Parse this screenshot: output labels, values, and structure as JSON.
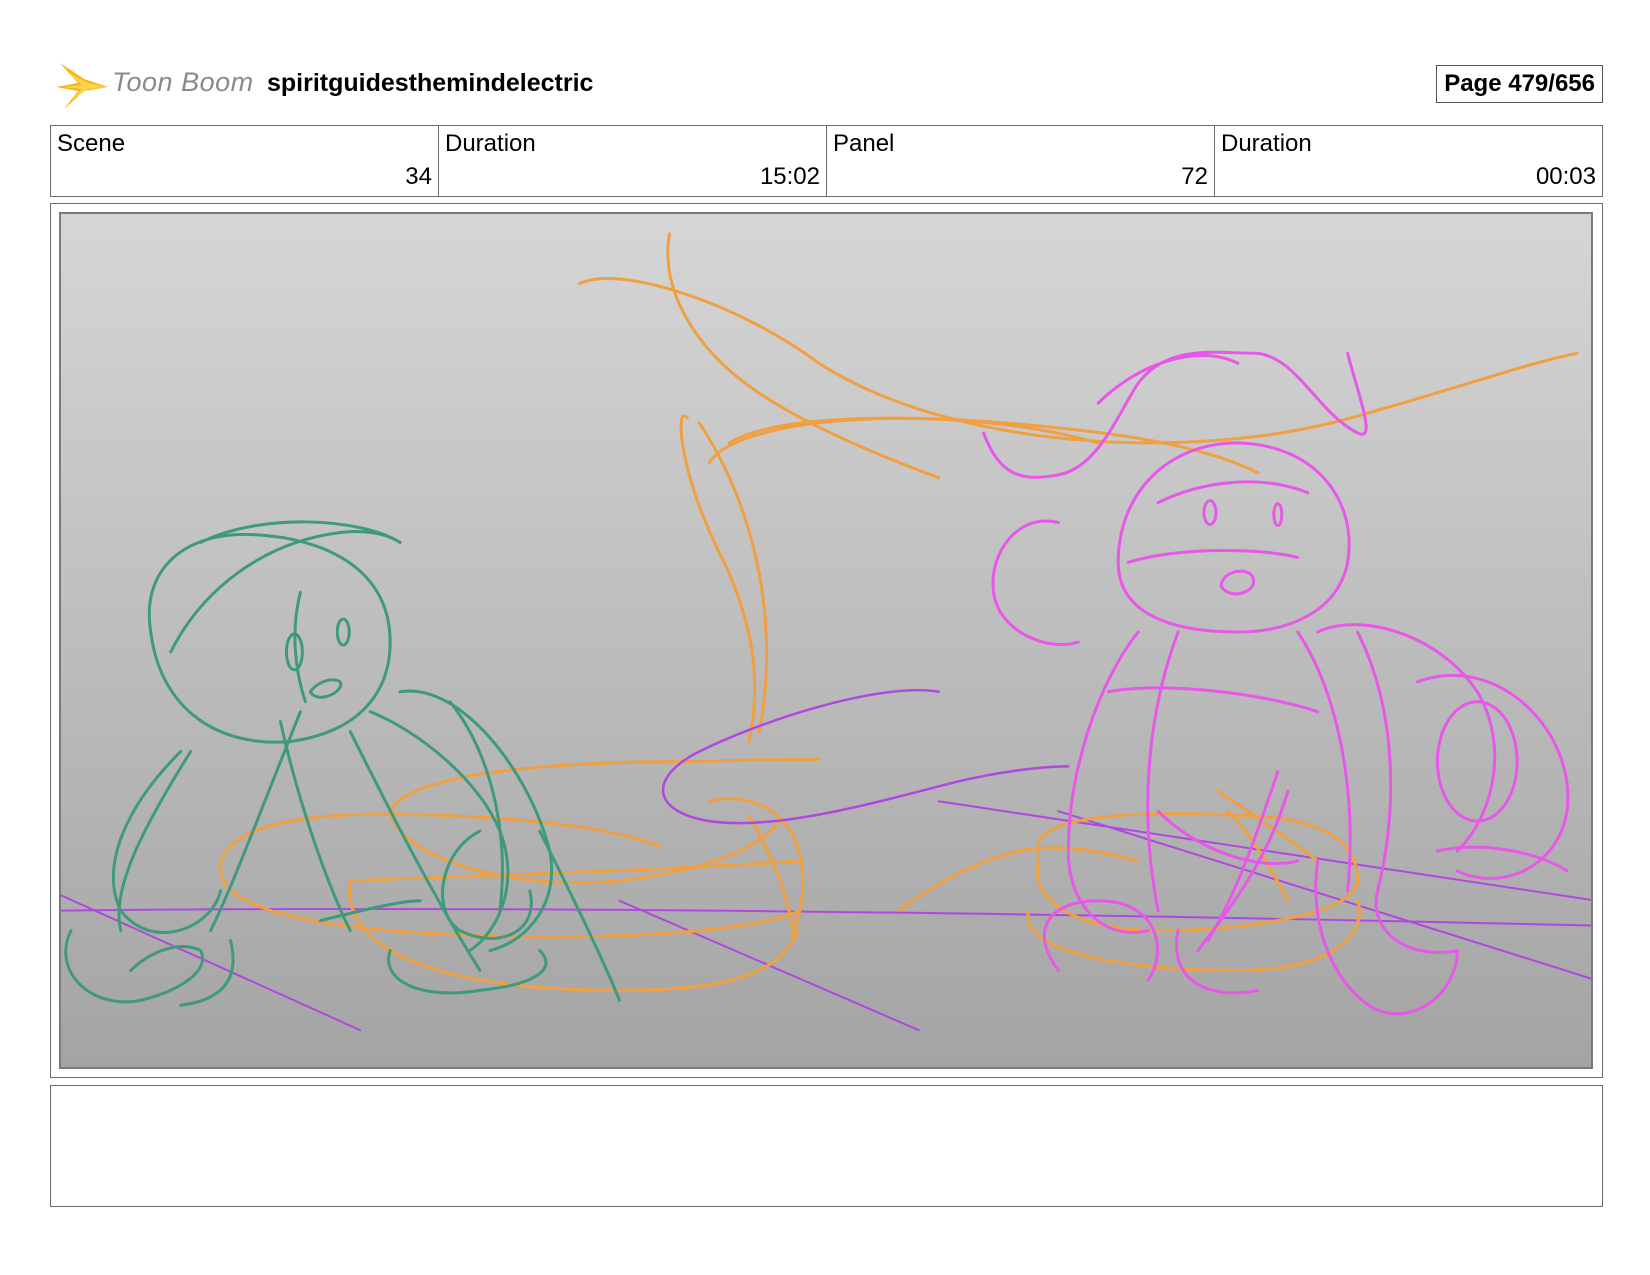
{
  "header": {
    "logo_text": "Toon Boom",
    "project_title": "spiritguidesthemindelectric",
    "page_label": "Page 479/656"
  },
  "info": {
    "scene_label": "Scene",
    "scene_value": "34",
    "scene_duration_label": "Duration",
    "scene_duration_value": "15:02",
    "panel_label": "Panel",
    "panel_value": "72",
    "panel_duration_label": "Duration",
    "panel_duration_value": "00:03"
  },
  "notes": {
    "text": ""
  },
  "colors": {
    "sketch_green": "#3f9a7c",
    "sketch_orange": "#f0a040",
    "sketch_magenta": "#e858e8",
    "sketch_purple": "#b048e0"
  }
}
